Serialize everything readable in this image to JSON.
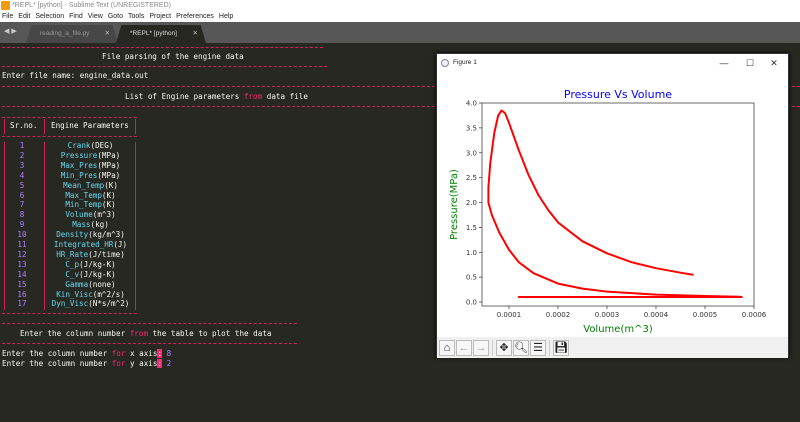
{
  "window": {
    "title": "*REPL* [python] - Sublime Text (UNREGISTERED)"
  },
  "menu": [
    "File",
    "Edit",
    "Selection",
    "Find",
    "View",
    "Goto",
    "Tools",
    "Project",
    "Preferences",
    "Help"
  ],
  "tabs": [
    {
      "label": "reading_a_file.py"
    },
    {
      "label": "*REPL* [python]"
    }
  ],
  "console": {
    "heading1": "File parsing of the engine data",
    "prompt_file": "Enter file name: ",
    "file_value": "engine_data.out",
    "heading2_a": "List of Engine parameters ",
    "heading2_kw": "from",
    "heading2_b": " data file",
    "col_srno": "Sr.no.",
    "col_params": "Engine Parameters",
    "rows": [
      {
        "no": "1",
        "name": "Crank",
        "unit": "(DEG)"
      },
      {
        "no": "2",
        "name": "Pressure",
        "unit": "(MPa)"
      },
      {
        "no": "3",
        "name": "Max_Pres",
        "unit": "(MPa)"
      },
      {
        "no": "4",
        "name": "Min_Pres",
        "unit": "(MPa)"
      },
      {
        "no": "5",
        "name": "Mean_Temp",
        "unit": "(K)"
      },
      {
        "no": "6",
        "name": "Max_Temp",
        "unit": "(K)"
      },
      {
        "no": "7",
        "name": "Min_Temp",
        "unit": "(K)"
      },
      {
        "no": "8",
        "name": "Volume",
        "unit": "(m^3)"
      },
      {
        "no": "9",
        "name": "Mass",
        "unit": "(kg)"
      },
      {
        "no": "10",
        "name": "Density",
        "unit": "(kg/m^3)"
      },
      {
        "no": "11",
        "name": "Integrated_HR",
        "unit": "(J)"
      },
      {
        "no": "12",
        "name": "HR_Rate",
        "unit": "(J/time)"
      },
      {
        "no": "13",
        "name": "C_p",
        "unit": "(J/kg-K)"
      },
      {
        "no": "14",
        "name": "C_v",
        "unit": "(J/kg-K)"
      },
      {
        "no": "15",
        "name": "Gamma",
        "unit": "(none)"
      },
      {
        "no": "16",
        "name": "Kin_Visc",
        "unit": "(m^2/s)"
      },
      {
        "no": "17",
        "name": "Dyn_Visc",
        "unit": "(N*s/m^2)"
      }
    ],
    "heading3_a": "Enter the column number ",
    "heading3_kw": "from",
    "heading3_b": " the table to plot the data",
    "x_prompt_a": "Enter the column number ",
    "x_prompt_kw": "for",
    "x_prompt_b": " x axis",
    "x_colon": ":",
    "x_value": "8",
    "y_prompt_a": "Enter the column number ",
    "y_prompt_kw": "for",
    "y_prompt_b": " y axis",
    "y_colon": ":",
    "y_value": "2"
  },
  "figure": {
    "title": "Figure 1",
    "minimize": "—",
    "maximize": "☐",
    "close": "✕"
  },
  "colors": {
    "line": "#ff0000",
    "title": "#0000ff",
    "labels": "#008000"
  },
  "chart_data": {
    "type": "line",
    "title": "Pressure Vs Volume",
    "xlabel": "Volume(m^3)",
    "ylabel": "Pressure(MPa)",
    "xlim": [
      4.5e-05,
      0.0006
    ],
    "ylim": [
      -0.08,
      4.0
    ],
    "xticks": [
      0.0001,
      0.0002,
      0.0003,
      0.0004,
      0.0005,
      0.0006
    ],
    "xtick_labels": [
      "0.0001",
      "0.0002",
      "0.0003",
      "0.0004",
      "0.0005",
      "0.0006"
    ],
    "yticks": [
      0,
      0.5,
      1,
      1.5,
      2,
      2.5,
      3,
      3.5,
      4
    ],
    "ytick_labels": [
      "0.0",
      "0.5",
      "1.0",
      "1.5",
      "2.0",
      "2.5",
      "3.0",
      "3.5",
      "4.0"
    ],
    "grid": false,
    "x": [
      0.00012,
      0.000575,
      0.00057,
      0.0005,
      0.0004,
      0.0003,
      0.00025,
      0.0002,
      0.00015,
      0.00012,
      0.0001,
      8e-05,
      6.5e-05,
      5.8e-05,
      5.8e-05,
      6.2e-05,
      7e-05,
      7.8e-05,
      8.5e-05,
      9.2e-05,
      0.0001,
      0.00012,
      0.00014,
      0.00016,
      0.00018,
      0.0002,
      0.00025,
      0.0003,
      0.00035,
      0.0004,
      0.00045,
      0.000475
    ],
    "y": [
      0.1,
      0.1,
      0.105,
      0.12,
      0.15,
      0.21,
      0.27,
      0.37,
      0.58,
      0.8,
      1.05,
      1.4,
      1.75,
      2.0,
      2.3,
      2.8,
      3.4,
      3.75,
      3.85,
      3.8,
      3.6,
      3.05,
      2.55,
      2.15,
      1.85,
      1.6,
      1.22,
      0.98,
      0.8,
      0.68,
      0.59,
      0.55
    ]
  },
  "toolbar": [
    "home",
    "back",
    "forward",
    "pan",
    "zoom",
    "configure",
    "save"
  ]
}
